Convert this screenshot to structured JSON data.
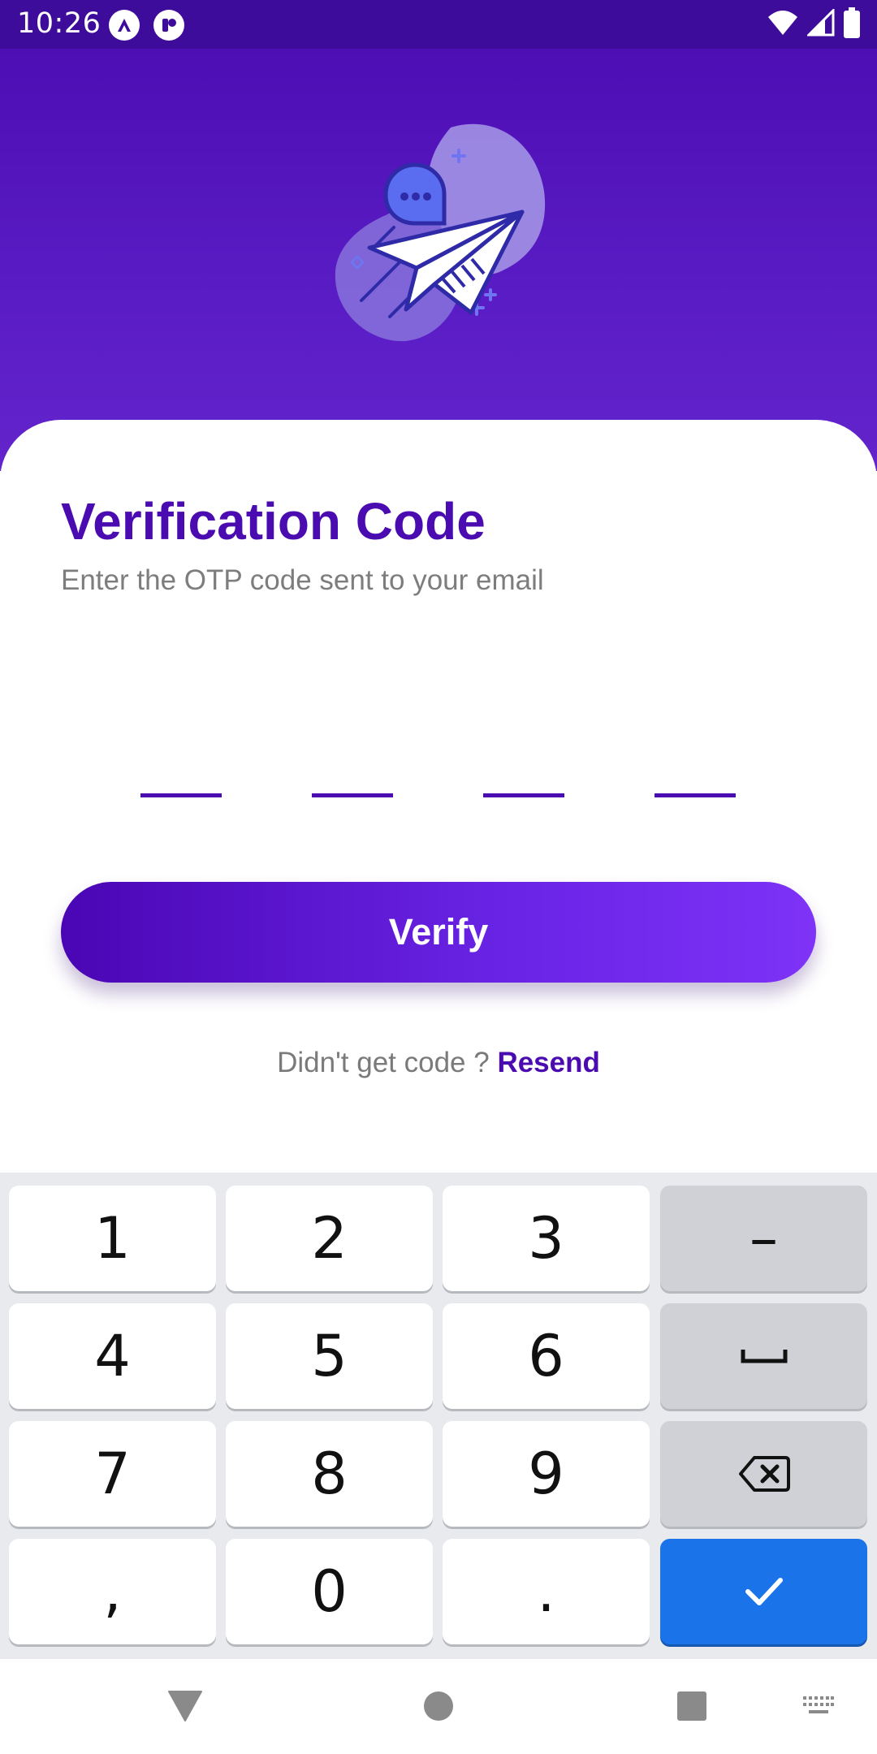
{
  "status_bar": {
    "time": "10:26",
    "icons": [
      "app-a-icon",
      "app-r-icon",
      "wifi-icon",
      "cell-signal-icon",
      "battery-icon"
    ]
  },
  "header": {
    "illustration": "paper-plane-chat-icon"
  },
  "verification": {
    "title": "Verification Code",
    "subtitle": "Enter the OTP code sent to your email",
    "otp_digits": [
      "",
      "",
      "",
      ""
    ],
    "verify_label": "Verify",
    "resend_prompt": "Didn't get code ?",
    "resend_label": "Resend"
  },
  "keyboard": {
    "rows": [
      [
        "1",
        "2",
        "3",
        "–"
      ],
      [
        "4",
        "5",
        "6",
        "space-icon"
      ],
      [
        "7",
        "8",
        "9",
        "backspace-icon"
      ],
      [
        ",",
        "0",
        ".",
        "checkmark-icon"
      ]
    ]
  },
  "nav_bar": {
    "icons": [
      "back-triangle-icon",
      "home-circle-icon",
      "recents-square-icon",
      "keyboard-switch-icon"
    ]
  },
  "colors": {
    "primary": "#4a0bb0",
    "header_gradient_top": "#4d0fb4",
    "button_gradient_end": "#7e33f7",
    "keyboard_bg": "#e8eaed",
    "keyboard_action": "#1a73e8"
  }
}
